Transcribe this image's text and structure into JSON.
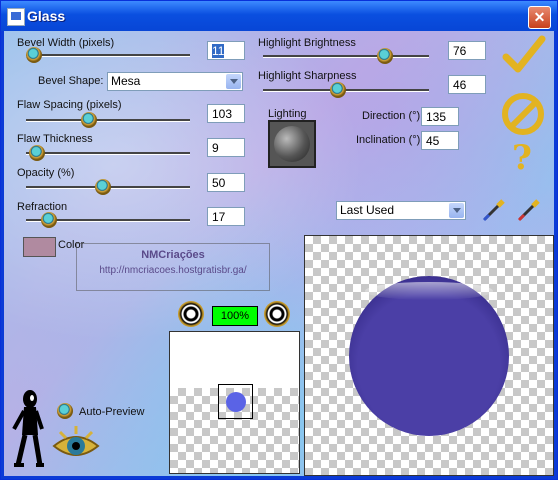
{
  "window": {
    "title": "Glass",
    "close_glyph": "✕"
  },
  "params_left": {
    "bevel_width_label": "Bevel Width (pixels)",
    "bevel_width_value": "11",
    "bevel_shape_label": "Bevel Shape:",
    "bevel_shape_value": "Mesa",
    "flaw_spacing_label": "Flaw Spacing (pixels)",
    "flaw_spacing_value": "103",
    "flaw_thickness_label": "Flaw Thickness",
    "flaw_thickness_value": "9",
    "opacity_label": "Opacity (%)",
    "opacity_value": "50",
    "refraction_label": "Refraction",
    "refraction_value": "17",
    "color_label": "Color"
  },
  "params_right": {
    "highlight_brightness_label": "Highlight Brightness",
    "highlight_brightness_value": "76",
    "highlight_sharpness_label": "Highlight Sharpness",
    "highlight_sharpness_value": "46",
    "lighting_label": "Lighting",
    "direction_label": "Direction (°)",
    "direction_value": "135",
    "inclination_label": "Inclination (°)",
    "inclination_value": "45"
  },
  "preset": {
    "value": "Last Used"
  },
  "watermark": {
    "title": "NMCriações",
    "url": "http://nmcriacoes.hostgratisbr.ga/"
  },
  "zoom": {
    "value": "100%"
  },
  "auto_preview": {
    "label": "Auto-Preview"
  },
  "colors": {
    "swatch": "#b08aa0",
    "glass": "#4b3fa6",
    "zoom_bg": "#00ff00"
  },
  "icons": [
    "ok-check-icon",
    "cancel-icon",
    "help-icon",
    "eyedropper-icon",
    "brush-icon",
    "zoom-in-icon",
    "zoom-out-icon"
  ]
}
